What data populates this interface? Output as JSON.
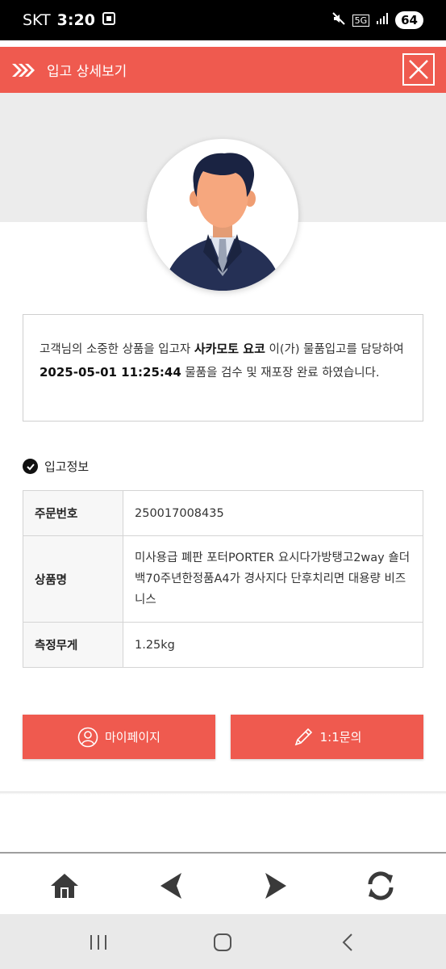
{
  "status_bar": {
    "carrier": "SKT",
    "time": "3:20",
    "network": "5G",
    "battery": "64"
  },
  "header": {
    "title": "입고 상세보기"
  },
  "message": {
    "part1": "고객님의 소중한 상품을 입고자 ",
    "staff_name": "사카모토 요코",
    "part2": " 이(가) 물품입고를 담당하여 ",
    "datetime": "2025-05-01 11:25:44",
    "part3": " 물품을 검수 및 재포장 완료 하였습니다."
  },
  "section": {
    "title": "입고정보"
  },
  "info": {
    "order_label": "주문번호",
    "order_value": "250017008435",
    "product_label": "상품명",
    "product_value": "미사용급 폐판 포터PORTER 요시다가방탱고2way 숄더백70주년한정품A4가 경사지다 단후치리면 대용량 비즈니스",
    "weight_label": "측정무게",
    "weight_value": "1.25kg"
  },
  "buttons": {
    "mypage": "마이페이지",
    "inquiry": "1:1문의"
  },
  "icons": {
    "home": "home-icon",
    "back": "arrow-left-icon",
    "forward": "arrow-right-icon",
    "refresh": "refresh-icon"
  },
  "colors": {
    "accent": "#ef5a4f"
  }
}
